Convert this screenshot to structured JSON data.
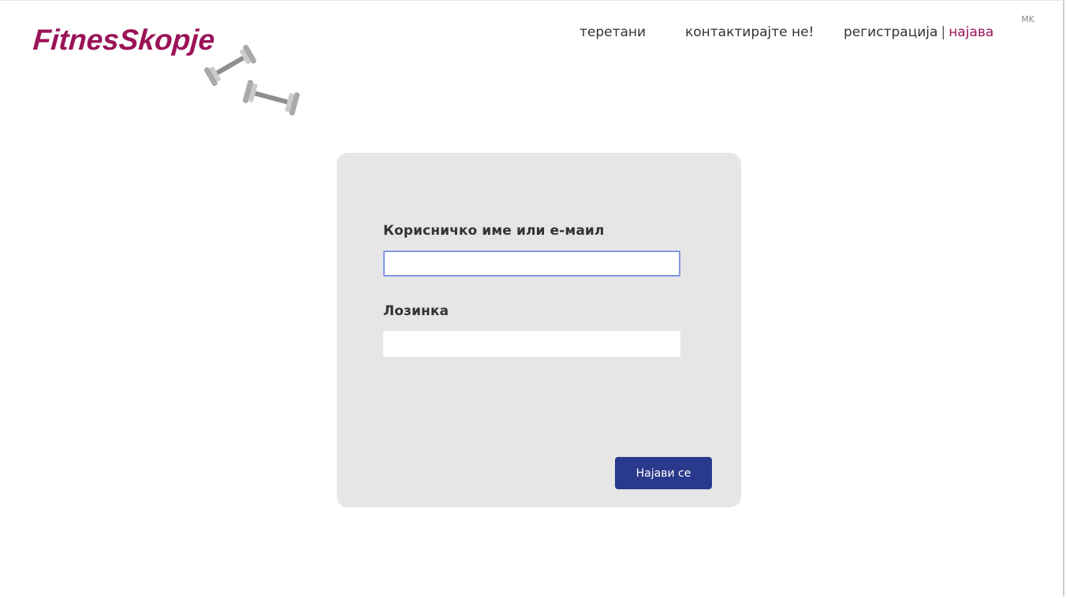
{
  "header": {
    "logo_text": "FitnesSkopje",
    "logo_icon": "dumbbells-icon",
    "brand_color": "#9b1457",
    "nav": {
      "gyms": "теретани",
      "contact": "контактирајте не!",
      "register": "регистрација",
      "separator": "|",
      "login": "најава"
    },
    "language": "MK"
  },
  "login_form": {
    "username_label": "Корисничко име или е-маил",
    "username_value": "",
    "password_label": "Лозинка",
    "password_value": "",
    "submit_label": "Најави се",
    "button_color": "#29398b",
    "focus_color": "#8197e0"
  }
}
